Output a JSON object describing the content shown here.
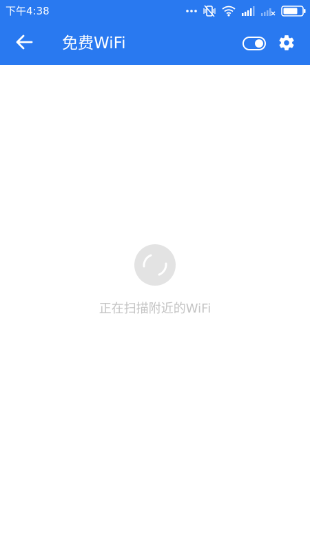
{
  "status_bar": {
    "time": "下午4:38",
    "icons": [
      "more-dots-icon",
      "vibrate-off-icon",
      "wifi-signal-icon",
      "cell-signal-icon",
      "cell-signal-no-service-icon",
      "battery-icon"
    ]
  },
  "app_bar": {
    "title": "免费WiFi",
    "back_icon": "arrow-left-icon",
    "toggle_on": true,
    "settings_icon": "gear-icon"
  },
  "main": {
    "loading_icon": "spinner-icon",
    "scan_status": "正在扫描附近的WiFi"
  },
  "colors": {
    "primary": "#2979f0",
    "background": "#ffffff",
    "muted_text": "#c4c4c4",
    "spinner": "#e0e0e0"
  }
}
